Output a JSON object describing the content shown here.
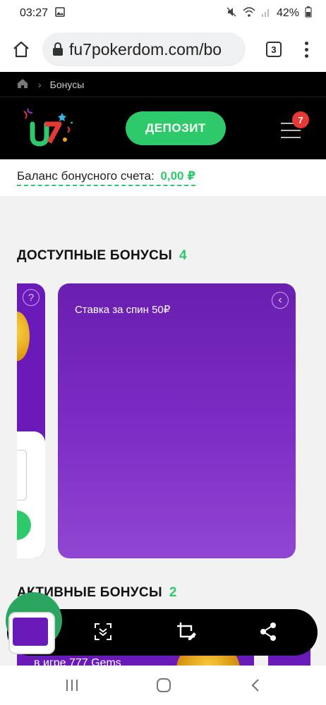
{
  "status": {
    "time": "03:27",
    "battery": "42%"
  },
  "browser": {
    "url": "fu7pokerdom.com/bo",
    "tab_count": "3"
  },
  "breadcrumb": {
    "current": "Бонусы"
  },
  "header": {
    "deposit_label": "ДЕПОЗИТ",
    "menu_badge": "7"
  },
  "balance": {
    "label": "Баланс бонусного счета:",
    "value": "0,00 ₽"
  },
  "available": {
    "title": "ДОСТУПНЫЕ БОНУСЫ",
    "count": "4"
  },
  "card": {
    "title": "Ставка за спин 50₽"
  },
  "active": {
    "title": "АКТИВНЫЕ БОНУСЫ",
    "count": "2"
  },
  "active_card": {
    "text": "в игре 777 Gems"
  },
  "colors": {
    "accent": "#2ec96b",
    "card_purple": "#6a1ab8",
    "badge": "#e53935"
  }
}
